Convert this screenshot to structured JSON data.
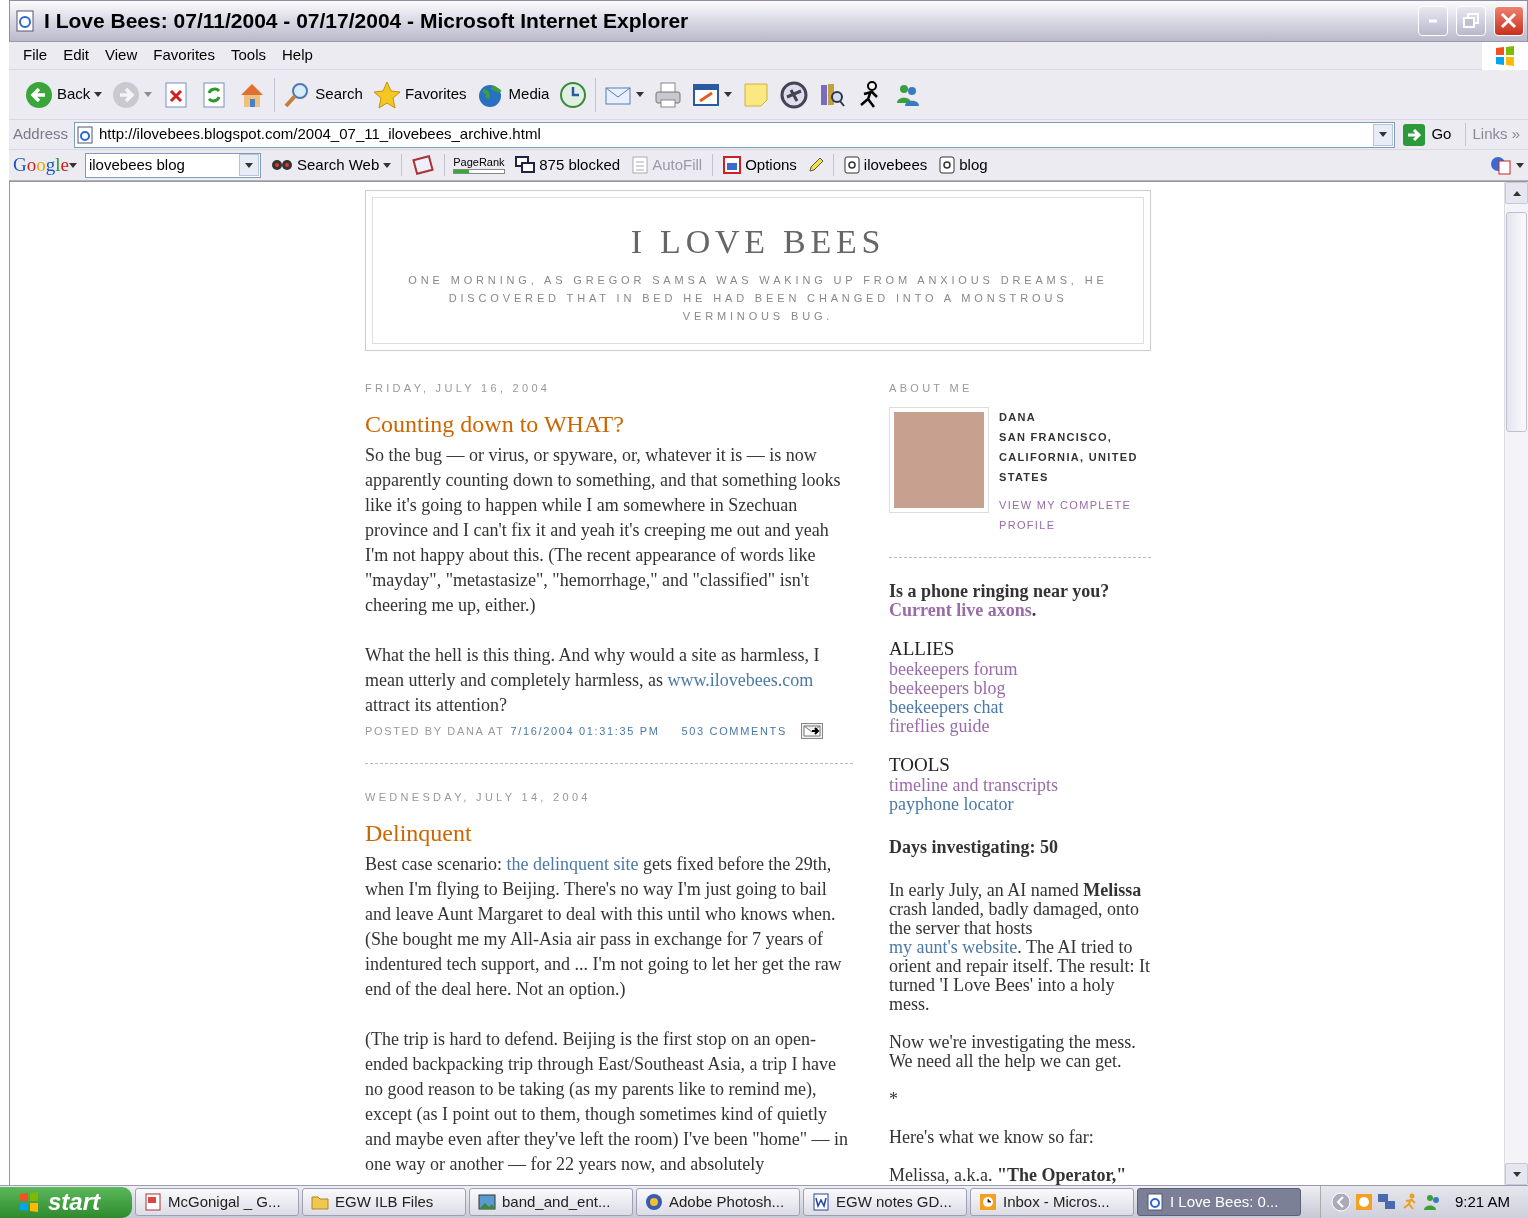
{
  "window": {
    "title": "I Love Bees: 07/11/2004 - 07/17/2004 - Microsoft Internet Explorer"
  },
  "menu": [
    "File",
    "Edit",
    "View",
    "Favorites",
    "Tools",
    "Help"
  ],
  "toolbar": {
    "groups": [
      [
        {
          "kind": "labeled",
          "label": "Back",
          "menu": true,
          "disabled": false
        },
        {
          "kind": "icon",
          "menu": true,
          "disabled": true
        },
        {
          "kind": "icon",
          "menu": false,
          "disabled": false
        },
        {
          "kind": "icon",
          "menu": false,
          "disabled": false
        },
        {
          "kind": "icon",
          "menu": false,
          "disabled": false
        }
      ],
      [
        {
          "kind": "labeled",
          "label": "Search",
          "menu": false,
          "disabled": false
        },
        {
          "kind": "labeled",
          "label": "Favorites",
          "menu": false,
          "disabled": false
        },
        {
          "kind": "labeled",
          "label": "Media",
          "menu": false,
          "disabled": false
        },
        {
          "kind": "icon",
          "menu": false,
          "disabled": false
        }
      ],
      [
        {
          "kind": "icon",
          "menu": true,
          "disabled": false
        },
        {
          "kind": "icon",
          "menu": false,
          "disabled": false
        },
        {
          "kind": "icon",
          "menu": true,
          "disabled": false
        },
        {
          "kind": "icon",
          "menu": false,
          "disabled": false
        },
        {
          "kind": "icon",
          "menu": false,
          "disabled": false
        },
        {
          "kind": "icon",
          "menu": false,
          "disabled": false
        },
        {
          "kind": "icon",
          "menu": false,
          "disabled": false
        },
        {
          "kind": "icon",
          "menu": false,
          "disabled": false
        }
      ]
    ]
  },
  "address": {
    "label": "Address",
    "url": "http://ilovebees.blogspot.com/2004_07_11_ilovebees_archive.html",
    "go": "Go",
    "links": "Links",
    "more": "»"
  },
  "google_bar": {
    "logo": "Google",
    "query": "ilovebees blog",
    "search_button": "Search Web",
    "pagerank": {
      "label": "PageRank",
      "level": 0.3
    },
    "blocked": "875 blocked",
    "autofill": {
      "label": "AutoFill",
      "disabled": true
    },
    "options": "Options",
    "bookmarks": [
      "ilovebees",
      "blog"
    ]
  },
  "blog": {
    "title": "I LOVE BEES",
    "description": "ONE MORNING, AS GREGOR SAMSA WAS WAKING UP FROM ANXIOUS DREAMS, HE DISCOVERED THAT IN BED HE HAD BEEN CHANGED INTO A MONSTROUS VERMINOUS BUG.",
    "posts": [
      {
        "date": "FRIDAY, JULY 16, 2004",
        "title": "Counting down to WHAT?",
        "paragraphs": [
          [
            {
              "kind": "text",
              "text": "So the bug — or virus, or spyware, or, whatever it is — is now apparently counting down to something, and that something looks like it's going to happen while I am somewhere in Szechuan province and I can't fix it and yeah it's creeping me out and yeah I'm not happy about this.  (The recent appearance of words like \"mayday\", \"metastasize\", \"hemorrhage,\" and \"classified\" isn't cheering me up, either.)"
            }
          ],
          [
            {
              "kind": "text",
              "text": "What the hell is this thing.  And why would a site as harmless, I mean utterly and completely harmless, as "
            },
            {
              "kind": "link",
              "text": "www.ilovebees.com",
              "visited": false
            },
            {
              "kind": "text",
              "text": " attract its attention?"
            }
          ]
        ],
        "footer": {
          "posted_by": "POSTED BY DANA AT",
          "time": "7/16/2004 01:31:35 PM",
          "comments": "503 COMMENTS"
        }
      },
      {
        "date": "WEDNESDAY, JULY 14, 2004",
        "title": "Delinquent",
        "paragraphs": [
          [
            {
              "kind": "text",
              "text": "Best case scenario: "
            },
            {
              "kind": "link",
              "text": "the delinquent site",
              "visited": false
            },
            {
              "kind": "text",
              "text": " gets fixed before the 29th, when I'm flying to Beijing. There's no way I'm just going to bail and leave Aunt Margaret to deal with this until who knows when. (She bought me my All-Asia air pass in exchange for 7 years of indentured tech support, and ... I'm not going to let her get the raw end of the deal here. Not an option.)"
            }
          ],
          [
            {
              "kind": "text",
              "text": "(The trip is hard to defend. Beijing is the first stop on an open-ended backpacking trip through East/Southeast Asia, a trip I have no good reason to be taking (as my parents like to remind me), except (as I point out to them, though sometimes kind of quietly and maybe even after they've left the room) I've been \"home\" — in one way or another — for 22 years now, and absolutely"
            }
          ]
        ]
      }
    ]
  },
  "sidebar": {
    "about": {
      "heading": "ABOUT ME",
      "name": "DANA",
      "location": "SAN FRANCISCO, CALIFORNIA, UNITED STATES",
      "profile_link": "VIEW MY COMPLETE PROFILE"
    },
    "phone": {
      "question": "Is a phone ringing near you?",
      "link": "Current live axons",
      "after": "."
    },
    "link_groups": [
      {
        "heading": "ALLIES",
        "links": [
          {
            "text": "beekeepers forum",
            "visited": true
          },
          {
            "text": "beekeepers blog",
            "visited": true
          },
          {
            "text": "beekeepers chat",
            "visited": false
          },
          {
            "text": "fireflies guide",
            "visited": true
          }
        ]
      },
      {
        "heading": "TOOLS",
        "links": [
          {
            "text": "timeline and transcripts",
            "visited": true
          },
          {
            "text": "payphone locator",
            "visited": false
          }
        ]
      }
    ],
    "days": "Days investigating: 50",
    "notes": [
      [
        {
          "kind": "text",
          "text": "In early July, an AI named **Melissa** crash landed, badly damaged, onto the server that hosts "
        },
        {
          "kind": "link",
          "text": "my aunt's website",
          "visited": false
        },
        {
          "kind": "text",
          "text": ". The AI tried to orient and repair itself. The result: It turned 'I Love Bees' into a holy mess."
        }
      ],
      [
        {
          "kind": "text",
          "text": "Now we're investigating the mess. We need all the help we can get."
        }
      ],
      [
        {
          "kind": "text",
          "text": "*"
        }
      ],
      [
        {
          "kind": "text",
          "text": "Here's what we know so far:"
        }
      ],
      [
        {
          "kind": "text",
          "text": "Melissa, a.k.a. **\"The Operator,\"**"
        }
      ]
    ]
  },
  "taskbar": {
    "start": "start",
    "tasks": [
      {
        "label": "McGonigal _ G...",
        "selected": false
      },
      {
        "label": "EGW ILB Files",
        "selected": false
      },
      {
        "label": "band_and_ent...",
        "selected": false
      },
      {
        "label": "Adobe Photosh...",
        "selected": false
      },
      {
        "label": "EGW notes GD...",
        "selected": false
      },
      {
        "label": "Inbox - Micros...",
        "selected": false
      },
      {
        "label": "I Love Bees: 0...",
        "selected": true
      }
    ],
    "clock": "9:21 AM"
  }
}
